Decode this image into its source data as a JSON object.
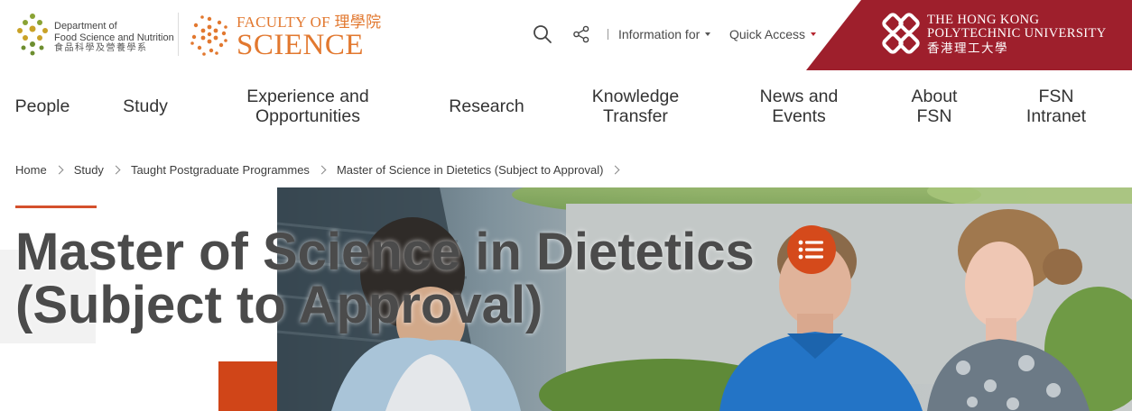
{
  "header": {
    "department": {
      "line1": "Department of",
      "line2": "Food Science and Nutrition",
      "chinese": "食品科學及營養學系"
    },
    "faculty": {
      "line1": "FACULTY OF 理學院",
      "line2": "SCIENCE"
    },
    "utility": {
      "search_icon": "search-icon",
      "share_icon": "share-icon",
      "information_for": "Information for",
      "quick_access": "Quick Access"
    },
    "university": {
      "line1": "THE HONG KONG",
      "line2": "POLYTECHNIC UNIVERSITY",
      "chinese": "香港理工大學",
      "band_color": "#9e1f2c"
    }
  },
  "nav": {
    "people": "People",
    "study": "Study",
    "experience_1": "Experience and",
    "experience_2": "Opportunities",
    "research": "Research",
    "knowledge_1": "Knowledge",
    "knowledge_2": "Transfer",
    "news_1": "News and",
    "news_2": "Events",
    "about_1": "About",
    "about_2": "FSN",
    "intranet_1": "FSN",
    "intranet_2": "Intranet"
  },
  "breadcrumb": {
    "home": "Home",
    "study": "Study",
    "taught": "Taught Postgraduate Programmes",
    "current": "Master of Science in Dietetics (Subject to Approval)"
  },
  "hero": {
    "title_line1": "Master of Science in Dietetics",
    "title_line2": "(Subject to Approval)",
    "toc_icon": "list-icon",
    "accent_color": "#d54a1b"
  }
}
